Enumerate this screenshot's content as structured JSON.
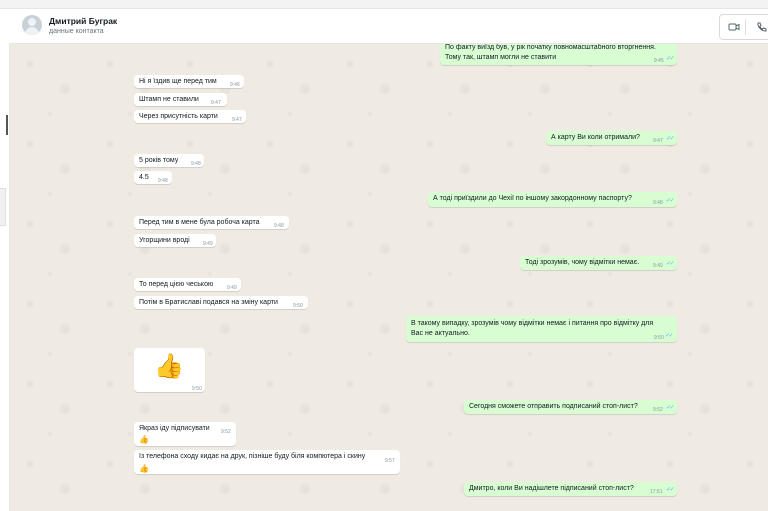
{
  "contact": {
    "name": "Дмитрий Буграк",
    "subtitle": "данные контакта"
  },
  "icons": {
    "video": "video-call-icon",
    "phone": "voice-call-icon",
    "read": "double-check-icon",
    "thumb": "thumbs-up-icon"
  },
  "messages": [
    {
      "dir": "out",
      "lines": [
        "По факту виїзд був, у рік початку повномасштабного вторгнення.",
        "Тому так, штамп могли не ставити"
      ],
      "time": "9:45"
    },
    {
      "dir": "in",
      "text": "Ні я їздив ще перед тим",
      "time": "9:46"
    },
    {
      "dir": "in",
      "text": "Штамп не ставили",
      "time": "9:47"
    },
    {
      "dir": "in",
      "text": "Через присутність карти",
      "time": "9:47"
    },
    {
      "dir": "out",
      "text": "А карту Ви коли отримали?",
      "time": "9:47"
    },
    {
      "dir": "in",
      "text": "5 років тому",
      "time": "9:48"
    },
    {
      "dir": "in",
      "text": "4.5",
      "time": "9:48"
    },
    {
      "dir": "out",
      "text": "А тоді приїздили до Чехії по іншому закордонному паспорту?",
      "time": "9:48"
    },
    {
      "dir": "in",
      "text": "Перед тим в мене була робоча карта",
      "time": "9:48"
    },
    {
      "dir": "in",
      "text": "Угорщини вроді",
      "time": "9:49"
    },
    {
      "dir": "out",
      "text": "Тоді зрозумів, чому відмітки немає.",
      "time": "9:49"
    },
    {
      "dir": "in",
      "text": "То перед цією чеською",
      "time": "9:49"
    },
    {
      "dir": "in",
      "text": "Потім в Братиславі подався на зміну карти",
      "time": "9:50"
    },
    {
      "dir": "out",
      "lines": [
        "В такому випадку, зрозумів чому відмітки немає і питання про відмітку для",
        "Вас не актуально."
      ],
      "time": "9:50"
    },
    {
      "dir": "in",
      "sticker": "👍",
      "time": "9:50"
    },
    {
      "dir": "out",
      "text": "Сегодня сможете отправить подписаний стоп-лист?",
      "time": "9:52"
    },
    {
      "dir": "in",
      "text": "Якраз іду підписувати",
      "time": "9:52",
      "emoji": "👍"
    },
    {
      "dir": "in",
      "text": "Із телефона сходу кидає на друк, пізніше буду біля компютера і скину",
      "time": "9:57",
      "emoji": "👍"
    },
    {
      "dir": "out",
      "text": "Дмитро, коли Ви надішлете підписаний стоп-лист?",
      "time": "17:51"
    }
  ]
}
